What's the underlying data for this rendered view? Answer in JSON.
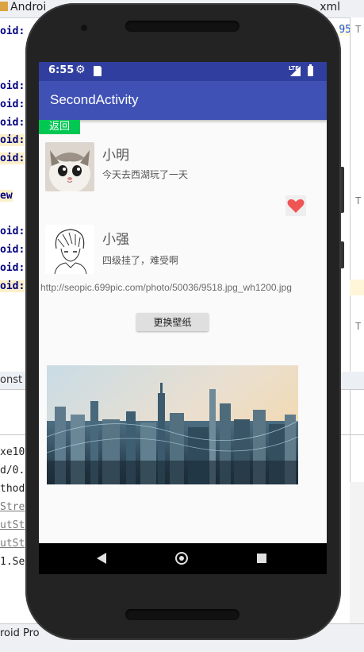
{
  "ide": {
    "title_left": "Androi",
    "title_right": "xml",
    "line_number": "95",
    "code_lines": [
      "oid:",
      "oid:",
      "oid:",
      "oid:",
      "oid:",
      "oid:",
      "ew",
      "oid:",
      "oid:",
      "oid:",
      "oid:"
    ],
    "panel_tab": "onst",
    "log_lines": [
      "xe10",
      "d/0.",
      "thod",
      "Stre",
      "utSt",
      "utSt",
      "1.Se"
    ],
    "status_text": "roid Pro",
    "right_marks": [
      "T",
      "T",
      "T"
    ]
  },
  "status_bar": {
    "time": "6:55",
    "lte": "LTE"
  },
  "app_bar": {
    "title": "SecondActivity"
  },
  "back_button": {
    "label": "返回"
  },
  "items": [
    {
      "name": "小明",
      "message": "今天去西湖玩了一天"
    },
    {
      "name": "小强",
      "message": "四级挂了，难受啊"
    }
  ],
  "heart_icon": "heart-icon",
  "url": {
    "text": "http://seopic.699pic.com/photo/50036/9518.jpg_wh1200.jpg"
  },
  "change_wallpaper_button": {
    "label": "更换壁纸"
  },
  "colors": {
    "status_bar": "#303f9f",
    "app_bar": "#3f51b5",
    "back_button": "#00c853",
    "heart": "#f05555"
  }
}
